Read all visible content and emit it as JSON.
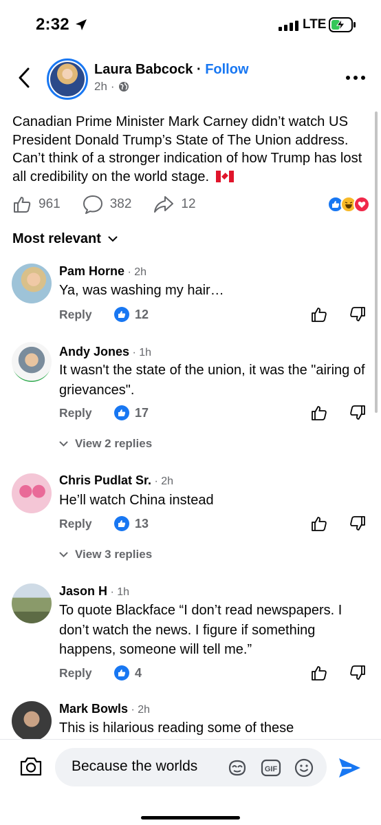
{
  "status_bar": {
    "time": "2:32",
    "network": "LTE"
  },
  "post": {
    "author": "Laura Babcock",
    "separator": "·",
    "follow_label": "Follow",
    "age": "2h",
    "audience_separator": "·",
    "audience_icon": "globe-icon",
    "text": "Canadian Prime Minister Mark Carney didn’t watch US President Donald Trump’s State of The Union address. Can’t think of a stronger indication of how Trump has lost all credibility on the world stage.",
    "flag_icon": "canada-flag-icon",
    "likes": "961",
    "comments": "382",
    "shares": "12",
    "reaction_icons": [
      "like-reaction-icon",
      "haha-reaction-icon",
      "love-reaction-icon"
    ]
  },
  "comments_header": {
    "sort_label": "Most relevant"
  },
  "comments": [
    {
      "name": "Pam Horne",
      "time": "2h",
      "text": "Ya, was washing my hair…",
      "reply_label": "Reply",
      "likes": "12"
    },
    {
      "name": "Andy Jones",
      "time": "1h",
      "text": "It wasn't the state of the union, it was the \"airing of grievances\".",
      "reply_label": "Reply",
      "likes": "17",
      "view_replies": "View 2 replies"
    },
    {
      "name": "Chris Pudlat Sr.",
      "time": "2h",
      "text": "He’ll watch China instead",
      "reply_label": "Reply",
      "likes": "13",
      "view_replies": "View 3 replies"
    },
    {
      "name": "Jason H",
      "time": "1h",
      "text": "To quote Blackface “I don’t read newspapers. I don’t watch the news. I figure if something happens, someone will tell me.”",
      "reply_label": "Reply",
      "likes": "4"
    },
    {
      "name": "Mark Bowls",
      "time": "2h",
      "text": "This is hilarious reading some of these"
    }
  ],
  "composer": {
    "input_value": "Because the worlds",
    "gif_label": "GIF"
  },
  "colors": {
    "accent": "#1877f2",
    "muted": "#65676b",
    "love": "#f02849",
    "haha": "#f7b928"
  }
}
